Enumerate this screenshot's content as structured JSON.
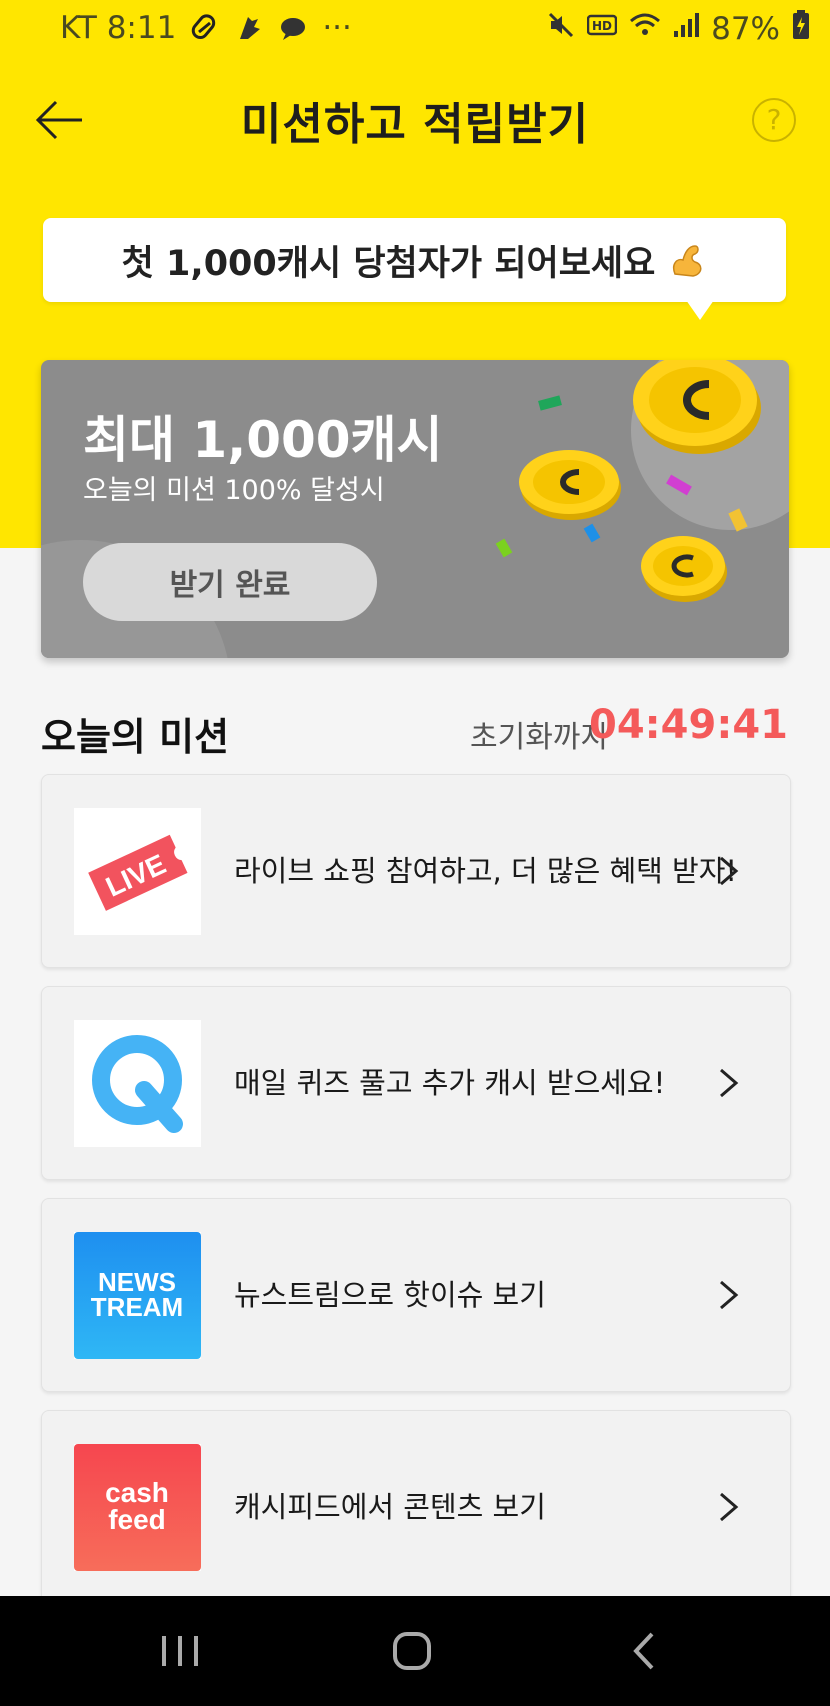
{
  "status_bar": {
    "carrier_time": "KT 8:11",
    "more": "···",
    "battery": "87%"
  },
  "header": {
    "title": "미션하고 적립받기",
    "help": "?"
  },
  "bubble": {
    "text": "첫 1,000캐시 당첨자가 되어보세요"
  },
  "reward": {
    "title": "최대 1,000캐시",
    "subtitle": "오늘의 미션 100% 달성시",
    "button": "받기 완료"
  },
  "missions": {
    "title": "오늘의 미션",
    "reset_label": "초기화까지",
    "reset_timer": "04:49:41",
    "items": [
      {
        "label": "라이브 쇼핑 참여하고, 더 많은 혜택 받자!",
        "icon": "live-icon"
      },
      {
        "label": "매일 퀴즈 풀고 추가 캐시 받으세요!",
        "icon": "quiz-icon"
      },
      {
        "label": "뉴스트림으로 핫이슈 보기",
        "icon": "newstream-icon"
      },
      {
        "label": "캐시피드에서 콘텐츠 보기",
        "icon": "cashfeed-icon"
      }
    ],
    "icon_text": {
      "live": "LIVE",
      "quiz": "Q",
      "news_line1": "NEWS",
      "news_line2": "TREAM",
      "cash_line1": "cash",
      "cash_line2": "feed"
    }
  },
  "colors": {
    "header_yellow": "#ffe600",
    "timer_red": "#f45a5a",
    "card_gray": "#8c8c8c"
  }
}
